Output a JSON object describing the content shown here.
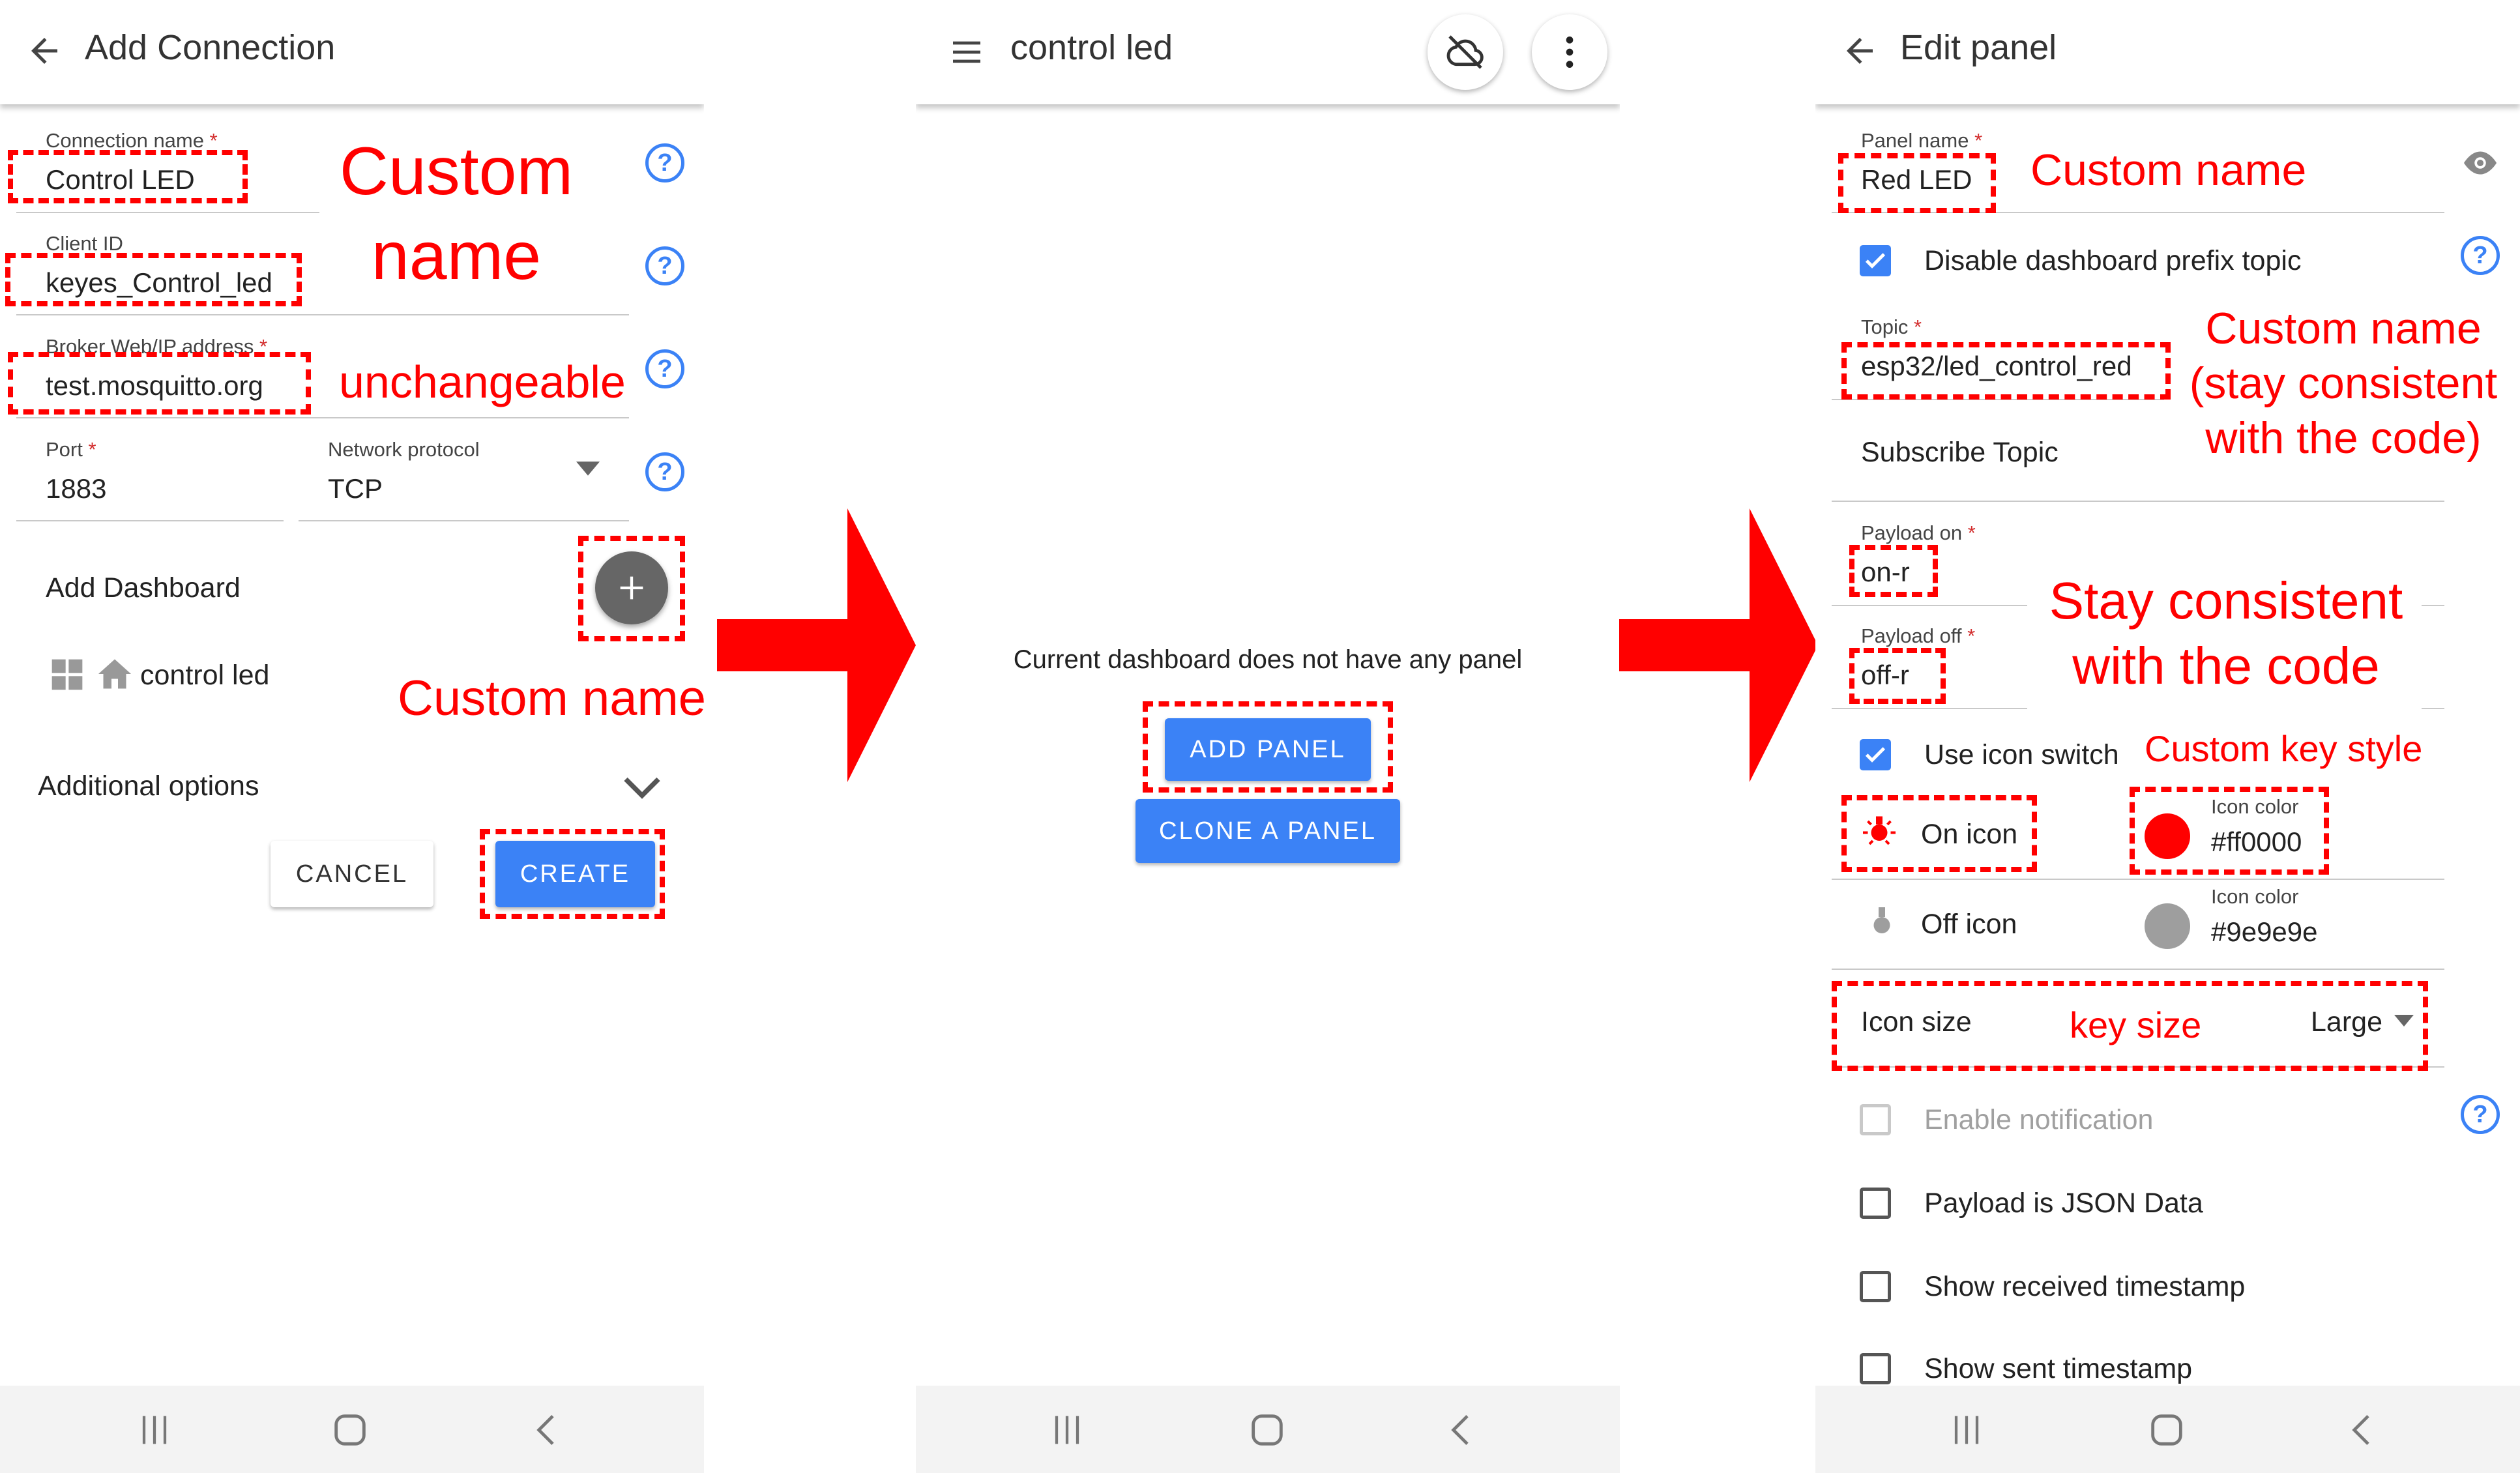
{
  "screen1": {
    "title": "Add Connection",
    "connection_name_label": "Connection name",
    "connection_name_value": "Control LED",
    "client_id_label": "Client ID",
    "client_id_value": "keyes_Control_led",
    "broker_label": "Broker Web/IP address",
    "broker_value": "test.mosquitto.org",
    "port_label": "Port",
    "port_value": "1883",
    "protocol_label": "Network protocol",
    "protocol_value": "TCP",
    "add_dashboard": "Add Dashboard",
    "dashboard_item": "control led",
    "additional_options": "Additional options",
    "cancel_label": "CANCEL",
    "create_label": "CREATE",
    "required_mark": "*",
    "anno_custom_name_1": "Custom",
    "anno_custom_name_2": "name",
    "anno_unchangeable": "unchangeable",
    "anno_custom_name_dash": "Custom name"
  },
  "screen2": {
    "title": "control led",
    "empty_message": "Current dashboard does not have any panel",
    "add_panel_label": "ADD PANEL",
    "clone_panel_label": "CLONE A PANEL"
  },
  "screen3": {
    "title": "Edit panel",
    "panel_name_label": "Panel name",
    "panel_name_value": "Red LED",
    "disable_prefix": "Disable dashboard prefix topic",
    "topic_label": "Topic",
    "topic_value": "esp32/led_control_red",
    "subscribe_topic": "Subscribe Topic",
    "payload_on_label": "Payload on",
    "payload_on_value": "on-r",
    "payload_off_label": "Payload off",
    "payload_off_value": "off-r",
    "use_icon_switch": "Use icon switch",
    "on_icon": "On icon",
    "off_icon": "Off icon",
    "icon_color_label": "Icon color",
    "on_color_value": "#ff0000",
    "off_color_value": "#9e9e9e",
    "icon_size_label": "Icon size",
    "icon_size_value": "Large",
    "enable_notification": "Enable notification",
    "payload_json": "Payload is JSON Data",
    "show_received": "Show received timestamp",
    "show_sent": "Show sent timestamp",
    "required_mark": "*",
    "anno_custom_name": "Custom name",
    "anno_topic_1": "Custom name",
    "anno_topic_2": "(stay consistent",
    "anno_topic_3": "with the code)",
    "anno_payload_1": "Stay consistent",
    "anno_payload_2": "with the code",
    "anno_key_style": "Custom key style",
    "anno_key_size": "key size"
  },
  "colors": {
    "accent_blue": "#3b82f6",
    "annotation_red": "#ff0000",
    "on_icon_color": "#ff0000",
    "off_icon_color": "#9e9e9e"
  }
}
